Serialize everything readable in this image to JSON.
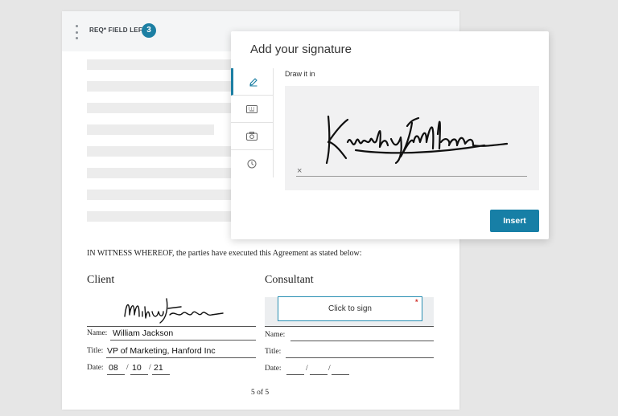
{
  "header": {
    "req_label": "REQ* FIELD LEFT",
    "req_count": "3"
  },
  "agreement": {
    "witness_text": "IN WITNESS WHEREOF, the parties have executed this Agreement as stated below:",
    "page_number": "5 of 5"
  },
  "client": {
    "title": "Client",
    "signature_name": "William Jackson",
    "name_label": "Name:",
    "name_value": "William Jackson",
    "title_label": "Title:",
    "title_value": "VP of Marketing, Hanford Inc",
    "date_label": "Date:",
    "date_month": "08",
    "date_day": "10",
    "date_year": "21",
    "date_sep": "/"
  },
  "consultant": {
    "title": "Consultant",
    "click_to_sign": "Click to sign",
    "required_mark": "*",
    "name_label": "Name:",
    "title_label": "Title:",
    "date_label": "Date:",
    "date_sep": "/"
  },
  "modal": {
    "title": "Add your signature",
    "draw_label": "Draw it in",
    "signature_name": "Kimberly Williams",
    "clear_mark": "×",
    "insert_label": "Insert",
    "tabs": [
      {
        "icon": "pen-icon",
        "active": true
      },
      {
        "icon": "keyboard-icon",
        "active": false
      },
      {
        "icon": "camera-icon",
        "active": false
      },
      {
        "icon": "clock-icon",
        "active": false
      }
    ]
  },
  "colors": {
    "accent": "#1c7fa3",
    "button": "#177fa6",
    "required": "#d0302a"
  }
}
